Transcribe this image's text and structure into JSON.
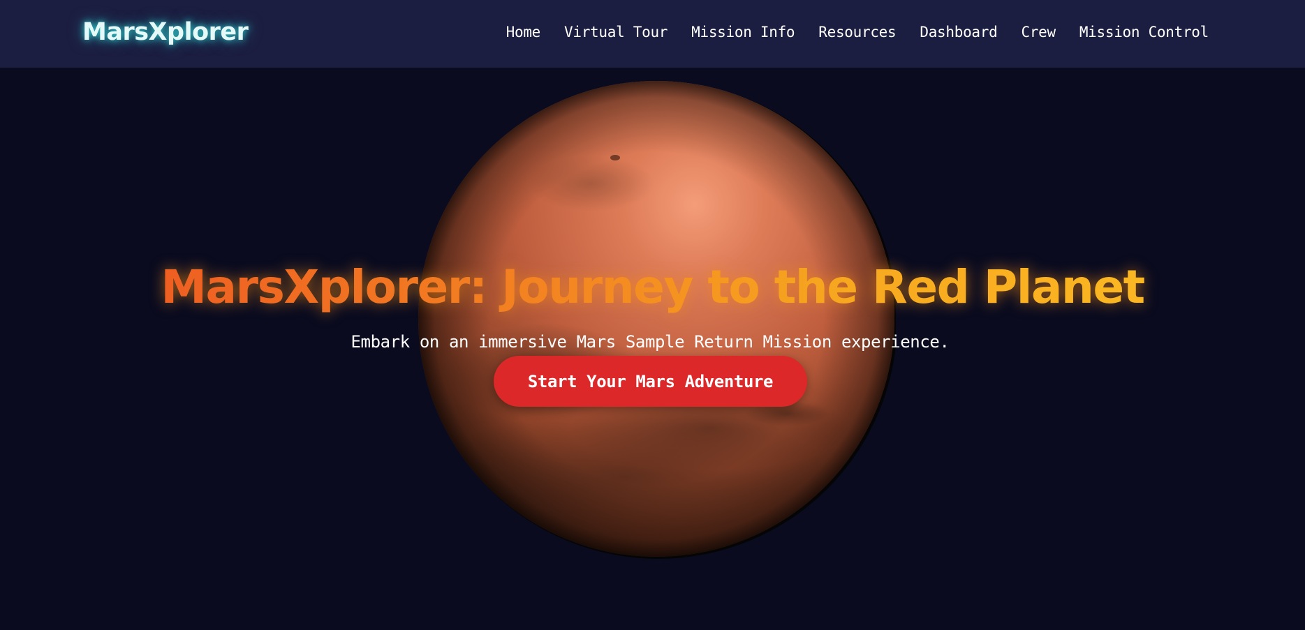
{
  "header": {
    "logo": "MarsXplorer",
    "nav": [
      {
        "label": "Home"
      },
      {
        "label": "Virtual Tour"
      },
      {
        "label": "Mission Info"
      },
      {
        "label": "Resources"
      },
      {
        "label": "Dashboard"
      },
      {
        "label": "Crew"
      },
      {
        "label": "Mission Control"
      }
    ]
  },
  "hero": {
    "title": "MarsXplorer: Journey to the Red Planet",
    "subtitle": "Embark on an immersive Mars Sample Return Mission experience.",
    "cta_label": "Start Your Mars Adventure"
  },
  "colors": {
    "page_background": "#0a0b1f",
    "navbar_background": "#1c1e41",
    "logo_glow": "#2fd4d4",
    "title_gradient_start": "#ee5f22",
    "title_gradient_end": "#fbb723",
    "cta_background": "#dc2828",
    "planet_surface": "#c2603f"
  }
}
